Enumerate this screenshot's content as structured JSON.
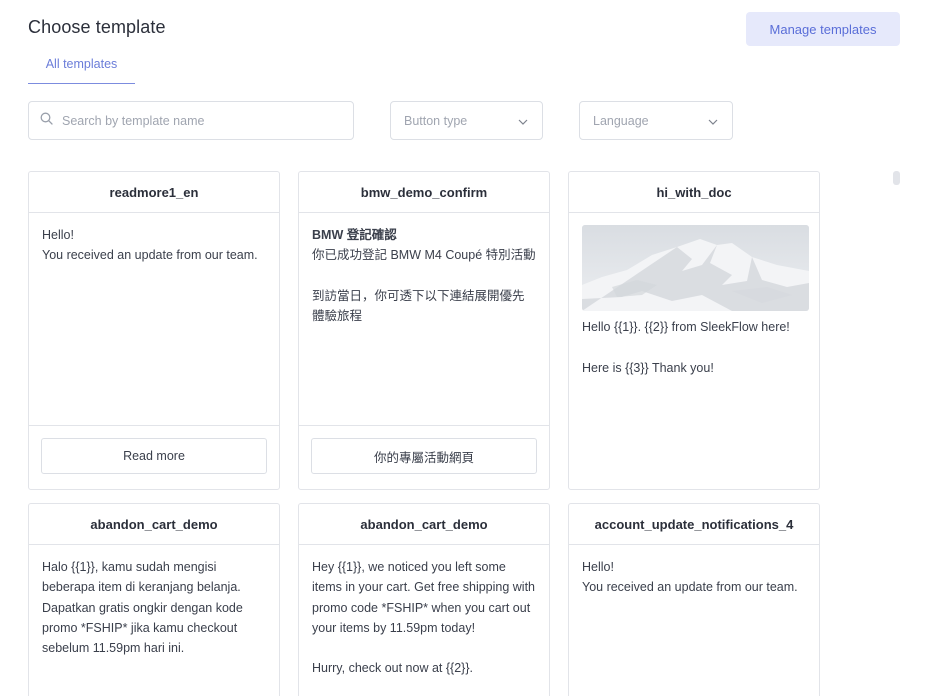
{
  "header": {
    "title": "Choose template",
    "manage_button": "Manage templates"
  },
  "tabs": [
    {
      "label": "All templates",
      "active": true
    }
  ],
  "filters": {
    "search_placeholder": "Search by template name",
    "search_value": "",
    "button_type_placeholder": "Button type",
    "language_placeholder": "Language"
  },
  "icons": {
    "search": "search-icon",
    "dropdown": "chevron-down-icon"
  },
  "colors": {
    "accent": "#6b7dd9",
    "accent_bg": "#e6e9fb",
    "border": "#e2e4e9"
  },
  "cards": [
    {
      "title": "readmore1_en",
      "body": "Hello!\nYou received an update from our team.",
      "button": "Read more"
    },
    {
      "title": "bmw_demo_confirm",
      "bold_line": "BMW 登記確認",
      "body": "你已成功登記 BMW M4 Coupé 特別活動\n\n到訪當日，你可透下以下連結展開優先體驗旅程",
      "button": "你的專屬活動網頁"
    },
    {
      "title": "hi_with_doc",
      "body": "Hello {{1}}. {{2}} from SleekFlow here!\n\nHere is {{3}} Thank you!"
    },
    {
      "title": "abandon_cart_demo",
      "body": "Halo {{1}}, kamu sudah mengisi beberapa item di keranjang belanja. Dapatkan gratis ongkir dengan kode promo *FSHIP* jika kamu checkout sebelum 11.59pm hari ini."
    },
    {
      "title": "abandon_cart_demo",
      "body": "Hey {{1}}, we noticed you left some items in your cart. Get free shipping with promo code *FSHIP* when you cart out your items by 11.59pm today!\n\nHurry, check out now at {{2}}."
    },
    {
      "title": "account_update_notifications_4",
      "body": "Hello!\nYou received an update from our team."
    }
  ]
}
